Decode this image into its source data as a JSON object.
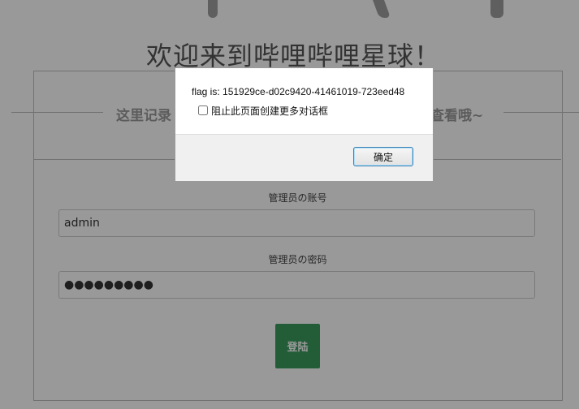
{
  "page": {
    "welcome_title": "欢迎来到哔哩哔哩星球！",
    "subtitle_left": "这里记录",
    "subtitle_right": "查看哦~"
  },
  "login_form": {
    "username_label": "管理员の账号",
    "username_value": "admin",
    "password_label": "管理员の密码",
    "password_value": "●●●●●●●●●",
    "login_button": "登陆",
    "login_button_color": "#3a9b5e"
  },
  "alert_dialog": {
    "message": "flag is: 151929ce-d02c9420-41461019-723eed48",
    "checkbox_label": "阻止此页面创建更多对话框",
    "checkbox_checked": false,
    "ok_button": "确定"
  }
}
